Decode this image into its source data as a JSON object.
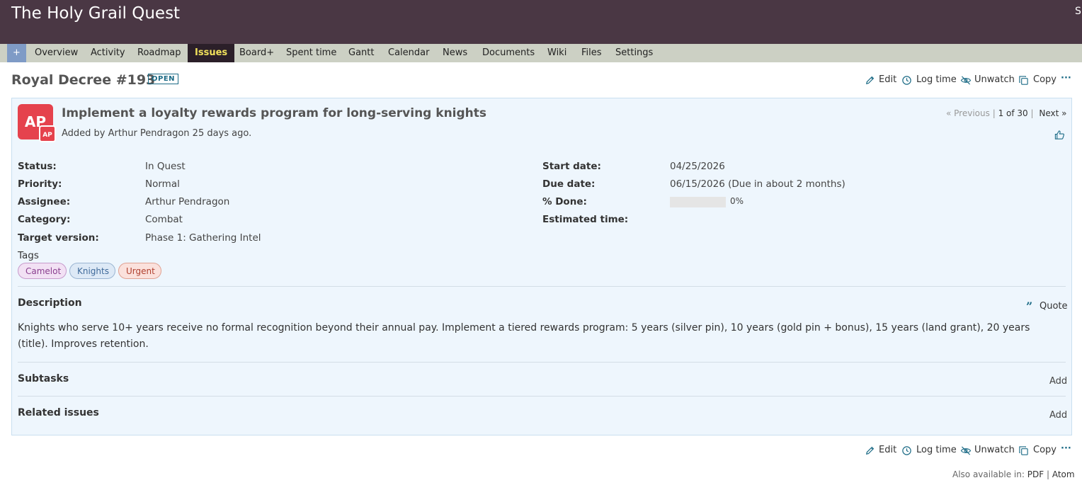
{
  "header": {
    "project_title": "The Holy Grail Quest",
    "right_clip": "S"
  },
  "menu": {
    "new": "+",
    "items": [
      "Overview",
      "Activity",
      "Roadmap",
      "Issues",
      "Board+",
      "Spent time",
      "Gantt",
      "Calendar",
      "News",
      "Documents",
      "Wiki",
      "Files",
      "Settings"
    ],
    "selected": "Issues"
  },
  "issue": {
    "heading": "Royal Decree #193",
    "status_badge": "OPEN",
    "subject": "Implement a loyalty rewards program for long-serving knights",
    "author_line": "Added by Arthur Pendragon 25 days ago.",
    "avatar_initials": "AP",
    "nav": {
      "previous": "« Previous",
      "sep1": "|",
      "position": "1 of 30",
      "sep2": "|",
      "next": "Next »"
    },
    "attributes_left": [
      {
        "label": "Status:",
        "value": "In Quest"
      },
      {
        "label": "Priority:",
        "value": "Normal"
      },
      {
        "label": "Assignee:",
        "value": "Arthur Pendragon"
      },
      {
        "label": "Category:",
        "value": "Combat"
      },
      {
        "label": "Target version:",
        "value": "Phase 1: Gathering Intel"
      }
    ],
    "attributes_right": [
      {
        "label": "Start date:",
        "value": "04/25/2026"
      },
      {
        "label": "Due date:",
        "value": "06/15/2026 (Due in about 2 months)"
      },
      {
        "label": "% Done:",
        "value": "0%"
      },
      {
        "label": "Estimated time:",
        "value": ""
      }
    ],
    "percent_done": 0,
    "tags_label": "Tags",
    "tags": [
      {
        "name": "Camelot",
        "color": "#8a3f8f"
      },
      {
        "name": "Knights",
        "color": "#3f6a9a"
      },
      {
        "name": "Urgent",
        "color": "#b0402f"
      }
    ],
    "description_title": "Description",
    "quote_label": "Quote",
    "description": "Knights who serve 10+ years receive no formal recognition beyond their annual pay. Implement a tiered rewards program: 5 years (silver pin), 10 years (gold pin + bonus), 15 years (land grant), 20 years (title). Improves retention.",
    "subtasks_title": "Subtasks",
    "related_title": "Related issues",
    "add_label": "Add"
  },
  "actions": {
    "edit": "Edit",
    "log_time": "Log time",
    "unwatch": "Unwatch",
    "copy": "Copy",
    "more": "···"
  },
  "footer": {
    "also_available": "Also available in:",
    "pdf": "PDF",
    "sep": "|",
    "atom": "Atom"
  },
  "colors": {
    "header": "#4a3744",
    "menu_bar": "#ccd0c4",
    "selected_tab": "#2b1f29",
    "accent_blue": "#1c6b86",
    "avatar": "#e5424d"
  }
}
